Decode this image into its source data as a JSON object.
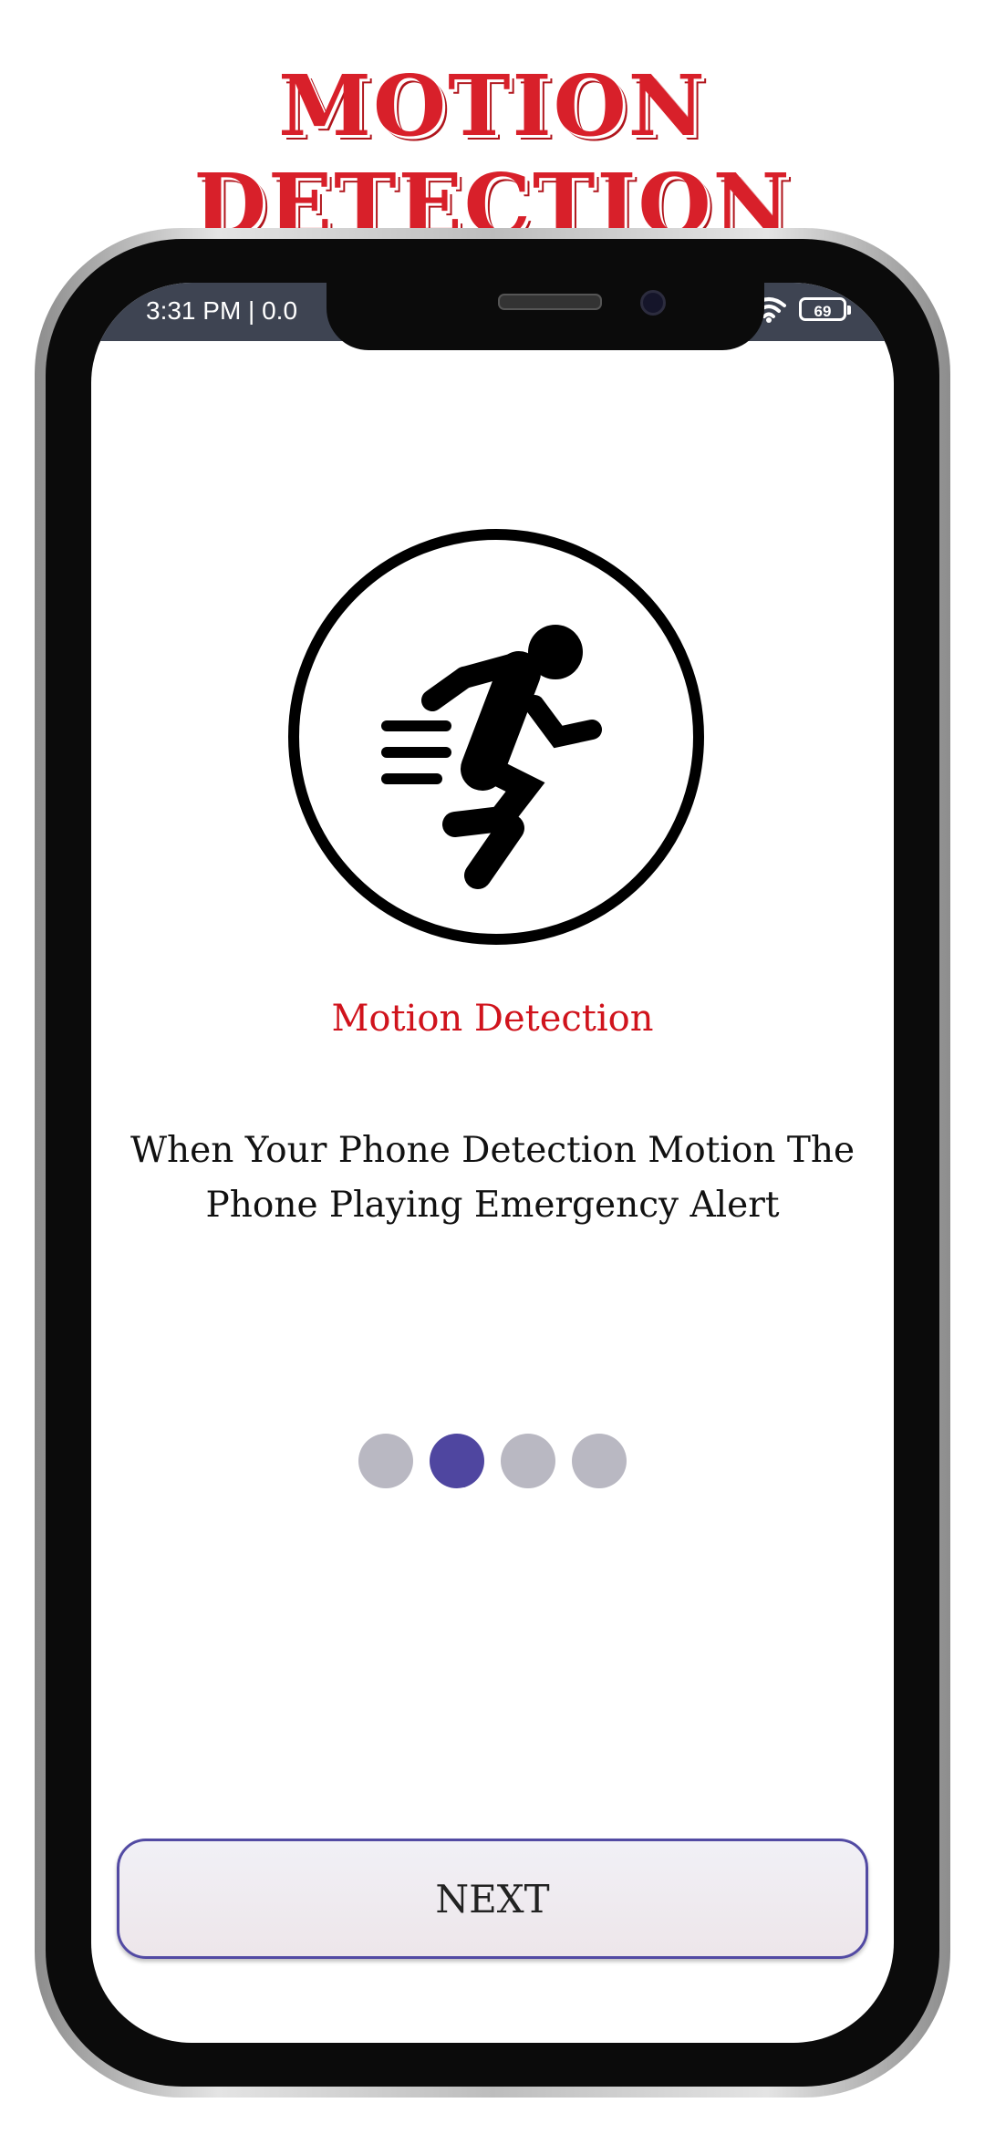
{
  "promo": {
    "title": "MOTION DETECTION"
  },
  "statusbar": {
    "time": "3:31 PM | 0.0",
    "battery": "69"
  },
  "onboarding": {
    "icon": "running-person-icon",
    "title": "Motion Detection",
    "description": "When Your Phone Detection Motion The Phone Playing Emergency Alert",
    "pages": 4,
    "current_page": 2,
    "next_label": "NEXT"
  },
  "colors": {
    "promo_title": "#d8202a",
    "screen_title": "#d0131c",
    "accent": "#4f46a0",
    "dot_inactive": "#b9b8c2",
    "statusbar": "#3e4452"
  }
}
